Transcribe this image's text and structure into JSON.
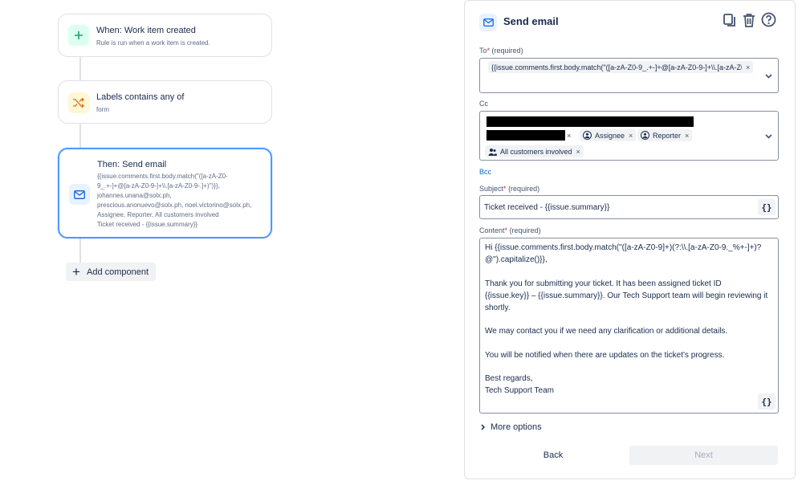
{
  "canvas": {
    "trigger": {
      "title": "When: Work item created",
      "subtitle": "Rule is run when a work item is created."
    },
    "condition": {
      "title": "Labels contains any of",
      "subtitle": "form"
    },
    "action": {
      "title": "Then: Send email",
      "body_lines": [
        "{{issue.comments.first.body.match(\"([a-zA-Z0-",
        "9_.+-]+@[a-zA-Z0-9-]+\\\\.[a-zA-Z0-9-.]+)\")}},",
        "johannes.unana@solx.ph,",
        "prescious.anonuevo@solx.ph, noel.victorino@solx.ph,",
        "Assignee, Reporter, All customers involved",
        "Ticket received - {{issue.summary}}"
      ]
    },
    "add_component_label": "Add component"
  },
  "panel": {
    "title": "Send email",
    "to": {
      "label": "To",
      "required_mark": "*",
      "hint": "(required)",
      "chip": "{{issue.comments.first.body.match(\"([a-zA-Z0-9_.+-]+@[a-zA-Z0-9-]+\\\\.[a-zA-Z0"
    },
    "cc": {
      "label": "Cc",
      "chips": [
        "Assignee",
        "Reporter",
        "All customers involved"
      ]
    },
    "bcc_label": "Bcc",
    "subject": {
      "label": "Subject",
      "required_mark": "*",
      "hint": "(required)",
      "value": "Ticket received - {{issue.summary}}"
    },
    "content": {
      "label": "Content",
      "required_mark": "*",
      "hint": "(required)",
      "lines": [
        "Hi {{issue.comments.first.body.match(\"([a-zA-Z0-9]+)(?:\\\\.[a-zA-Z0-9._%+-]+)?",
        "@\").capitalize()}},",
        "Thank you for submitting your ticket. It has been assigned ticket ID",
        "{{issue.key}} – {{issue.summary}}. Our Tech Support team will begin reviewing it",
        "shortly.",
        "We may contact you if we need any clarification or additional details.",
        "You will be notified when there are updates on the ticket's progress.",
        "Best regards,",
        "Tech Support Team"
      ]
    },
    "brace_label": "{}",
    "more_options_label": "More options",
    "back_label": "Back",
    "next_label": "Next"
  },
  "colors": {
    "accent": "#0c66e4",
    "selected_border": "#4c9aff",
    "required": "#c9372c"
  },
  "icons": [
    "plus-icon",
    "shuffle-icon",
    "mail-icon",
    "copy-icon",
    "trash-icon",
    "help-icon",
    "chevron-down-icon",
    "chevron-right-icon",
    "user-icon",
    "group-icon"
  ]
}
